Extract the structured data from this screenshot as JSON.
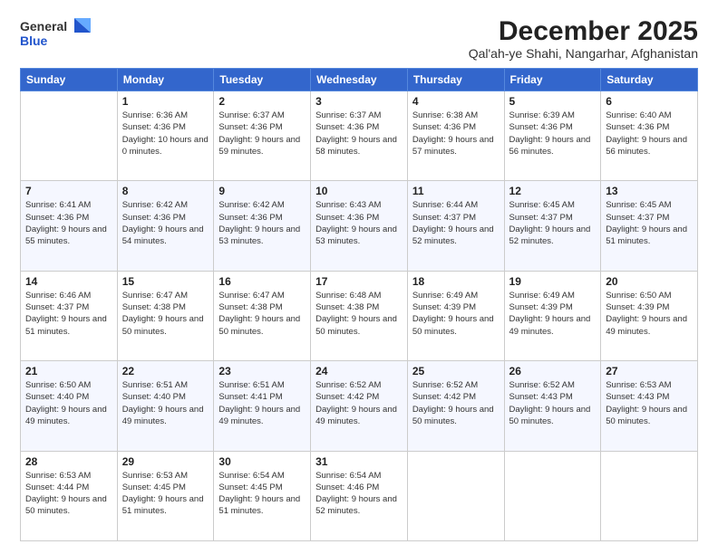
{
  "header": {
    "logo": {
      "line1": "General",
      "line2": "Blue"
    },
    "title": "December 2025",
    "subtitle": "Qal'ah-ye Shahi, Nangarhar, Afghanistan"
  },
  "weekdays": [
    "Sunday",
    "Monday",
    "Tuesday",
    "Wednesday",
    "Thursday",
    "Friday",
    "Saturday"
  ],
  "weeks": [
    [
      {
        "day": null
      },
      {
        "day": 1,
        "sunrise": "Sunrise: 6:36 AM",
        "sunset": "Sunset: 4:36 PM",
        "daylight": "Daylight: 10 hours and 0 minutes."
      },
      {
        "day": 2,
        "sunrise": "Sunrise: 6:37 AM",
        "sunset": "Sunset: 4:36 PM",
        "daylight": "Daylight: 9 hours and 59 minutes."
      },
      {
        "day": 3,
        "sunrise": "Sunrise: 6:37 AM",
        "sunset": "Sunset: 4:36 PM",
        "daylight": "Daylight: 9 hours and 58 minutes."
      },
      {
        "day": 4,
        "sunrise": "Sunrise: 6:38 AM",
        "sunset": "Sunset: 4:36 PM",
        "daylight": "Daylight: 9 hours and 57 minutes."
      },
      {
        "day": 5,
        "sunrise": "Sunrise: 6:39 AM",
        "sunset": "Sunset: 4:36 PM",
        "daylight": "Daylight: 9 hours and 56 minutes."
      },
      {
        "day": 6,
        "sunrise": "Sunrise: 6:40 AM",
        "sunset": "Sunset: 4:36 PM",
        "daylight": "Daylight: 9 hours and 56 minutes."
      }
    ],
    [
      {
        "day": 7,
        "sunrise": "Sunrise: 6:41 AM",
        "sunset": "Sunset: 4:36 PM",
        "daylight": "Daylight: 9 hours and 55 minutes."
      },
      {
        "day": 8,
        "sunrise": "Sunrise: 6:42 AM",
        "sunset": "Sunset: 4:36 PM",
        "daylight": "Daylight: 9 hours and 54 minutes."
      },
      {
        "day": 9,
        "sunrise": "Sunrise: 6:42 AM",
        "sunset": "Sunset: 4:36 PM",
        "daylight": "Daylight: 9 hours and 53 minutes."
      },
      {
        "day": 10,
        "sunrise": "Sunrise: 6:43 AM",
        "sunset": "Sunset: 4:36 PM",
        "daylight": "Daylight: 9 hours and 53 minutes."
      },
      {
        "day": 11,
        "sunrise": "Sunrise: 6:44 AM",
        "sunset": "Sunset: 4:37 PM",
        "daylight": "Daylight: 9 hours and 52 minutes."
      },
      {
        "day": 12,
        "sunrise": "Sunrise: 6:45 AM",
        "sunset": "Sunset: 4:37 PM",
        "daylight": "Daylight: 9 hours and 52 minutes."
      },
      {
        "day": 13,
        "sunrise": "Sunrise: 6:45 AM",
        "sunset": "Sunset: 4:37 PM",
        "daylight": "Daylight: 9 hours and 51 minutes."
      }
    ],
    [
      {
        "day": 14,
        "sunrise": "Sunrise: 6:46 AM",
        "sunset": "Sunset: 4:37 PM",
        "daylight": "Daylight: 9 hours and 51 minutes."
      },
      {
        "day": 15,
        "sunrise": "Sunrise: 6:47 AM",
        "sunset": "Sunset: 4:38 PM",
        "daylight": "Daylight: 9 hours and 50 minutes."
      },
      {
        "day": 16,
        "sunrise": "Sunrise: 6:47 AM",
        "sunset": "Sunset: 4:38 PM",
        "daylight": "Daylight: 9 hours and 50 minutes."
      },
      {
        "day": 17,
        "sunrise": "Sunrise: 6:48 AM",
        "sunset": "Sunset: 4:38 PM",
        "daylight": "Daylight: 9 hours and 50 minutes."
      },
      {
        "day": 18,
        "sunrise": "Sunrise: 6:49 AM",
        "sunset": "Sunset: 4:39 PM",
        "daylight": "Daylight: 9 hours and 50 minutes."
      },
      {
        "day": 19,
        "sunrise": "Sunrise: 6:49 AM",
        "sunset": "Sunset: 4:39 PM",
        "daylight": "Daylight: 9 hours and 49 minutes."
      },
      {
        "day": 20,
        "sunrise": "Sunrise: 6:50 AM",
        "sunset": "Sunset: 4:39 PM",
        "daylight": "Daylight: 9 hours and 49 minutes."
      }
    ],
    [
      {
        "day": 21,
        "sunrise": "Sunrise: 6:50 AM",
        "sunset": "Sunset: 4:40 PM",
        "daylight": "Daylight: 9 hours and 49 minutes."
      },
      {
        "day": 22,
        "sunrise": "Sunrise: 6:51 AM",
        "sunset": "Sunset: 4:40 PM",
        "daylight": "Daylight: 9 hours and 49 minutes."
      },
      {
        "day": 23,
        "sunrise": "Sunrise: 6:51 AM",
        "sunset": "Sunset: 4:41 PM",
        "daylight": "Daylight: 9 hours and 49 minutes."
      },
      {
        "day": 24,
        "sunrise": "Sunrise: 6:52 AM",
        "sunset": "Sunset: 4:42 PM",
        "daylight": "Daylight: 9 hours and 49 minutes."
      },
      {
        "day": 25,
        "sunrise": "Sunrise: 6:52 AM",
        "sunset": "Sunset: 4:42 PM",
        "daylight": "Daylight: 9 hours and 50 minutes."
      },
      {
        "day": 26,
        "sunrise": "Sunrise: 6:52 AM",
        "sunset": "Sunset: 4:43 PM",
        "daylight": "Daylight: 9 hours and 50 minutes."
      },
      {
        "day": 27,
        "sunrise": "Sunrise: 6:53 AM",
        "sunset": "Sunset: 4:43 PM",
        "daylight": "Daylight: 9 hours and 50 minutes."
      }
    ],
    [
      {
        "day": 28,
        "sunrise": "Sunrise: 6:53 AM",
        "sunset": "Sunset: 4:44 PM",
        "daylight": "Daylight: 9 hours and 50 minutes."
      },
      {
        "day": 29,
        "sunrise": "Sunrise: 6:53 AM",
        "sunset": "Sunset: 4:45 PM",
        "daylight": "Daylight: 9 hours and 51 minutes."
      },
      {
        "day": 30,
        "sunrise": "Sunrise: 6:54 AM",
        "sunset": "Sunset: 4:45 PM",
        "daylight": "Daylight: 9 hours and 51 minutes."
      },
      {
        "day": 31,
        "sunrise": "Sunrise: 6:54 AM",
        "sunset": "Sunset: 4:46 PM",
        "daylight": "Daylight: 9 hours and 52 minutes."
      },
      {
        "day": null
      },
      {
        "day": null
      },
      {
        "day": null
      }
    ]
  ]
}
